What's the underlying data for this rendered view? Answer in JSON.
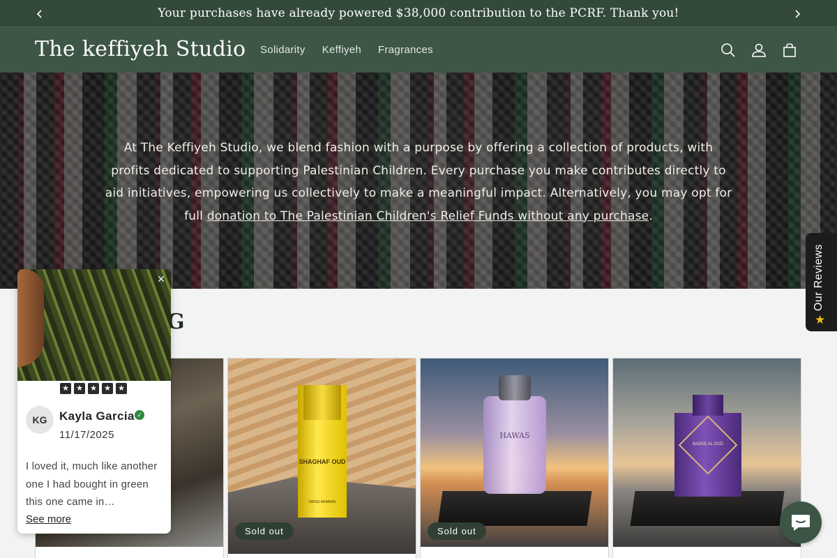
{
  "announcement": {
    "text": "Your purchases have already powered $38,000 contribution to the PCRF. Thank you!"
  },
  "header": {
    "logo": "The keffiyeh Studio",
    "nav": [
      "Solidarity",
      "Keffiyeh",
      "Fragrances"
    ],
    "icons": [
      "search-icon",
      "account-icon",
      "cart-icon"
    ]
  },
  "hero": {
    "text_before_link": "At The Keffiyeh Studio, we blend fashion with a purpose by offering a collection of products, with profits dedicated to supporting Palestinian Children. Every purchase you make contributes directly to aid initiatives, empowering us collectively to make a meaningful impact. Alternatively, you may opt for full ",
    "link_text": "donation to The Palestinian Children's Relief Funds without any purchase",
    "text_after_link": "."
  },
  "section": {
    "title_fragment": "IG"
  },
  "products": [
    {
      "badge": ""
    },
    {
      "badge": "Sold out",
      "bottle_name": "SHAGHAF OUD",
      "bottle_brand": "SWISS ARABIAN"
    },
    {
      "badge": "Sold out",
      "bottle_name": "HAWAS"
    },
    {
      "badge": "",
      "bottle_name": "BADEE AL OUD"
    }
  ],
  "review_popup": {
    "rating": 5,
    "initials": "KG",
    "name": "Kayla Garcia",
    "date": "11/17/2025",
    "body": "I loved it, much like another one I had bought in green this one came in…",
    "see_more": "See more"
  },
  "reviews_tab": {
    "label": "Our Reviews"
  },
  "colors": {
    "announcement_bg": "#334a3b",
    "header_bg": "#3d5646",
    "badge_bg": "#2f3f34",
    "chat_bg": "#3c5545",
    "review_star": "#f4c20d"
  }
}
